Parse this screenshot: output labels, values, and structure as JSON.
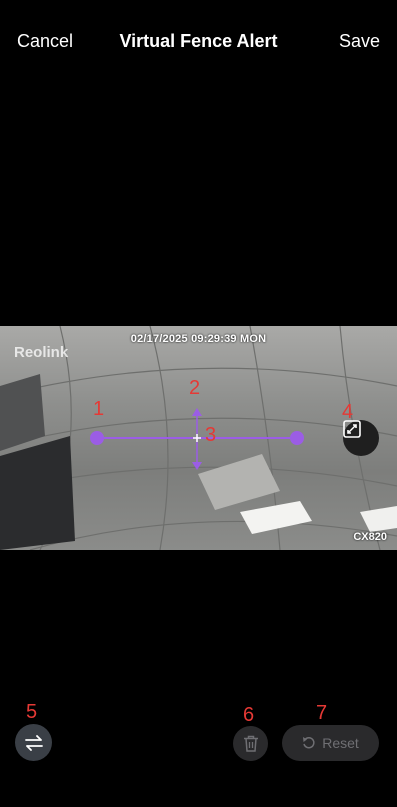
{
  "header": {
    "cancel_label": "Cancel",
    "title": "Virtual Fence Alert",
    "save_label": "Save"
  },
  "video": {
    "timestamp": "02/17/2025 09:29:39 MON",
    "brand": "Reolink",
    "model": "CX820"
  },
  "fence": {
    "color": "#9b5de5"
  },
  "markers": [
    "1",
    "2",
    "3",
    "4",
    "5",
    "6",
    "7"
  ],
  "bottom": {
    "reset_label": "Reset"
  },
  "icons": {
    "expand": "expand-icon",
    "swap": "swap-arrows-icon",
    "trash": "trash-icon",
    "reset": "reset-icon"
  }
}
